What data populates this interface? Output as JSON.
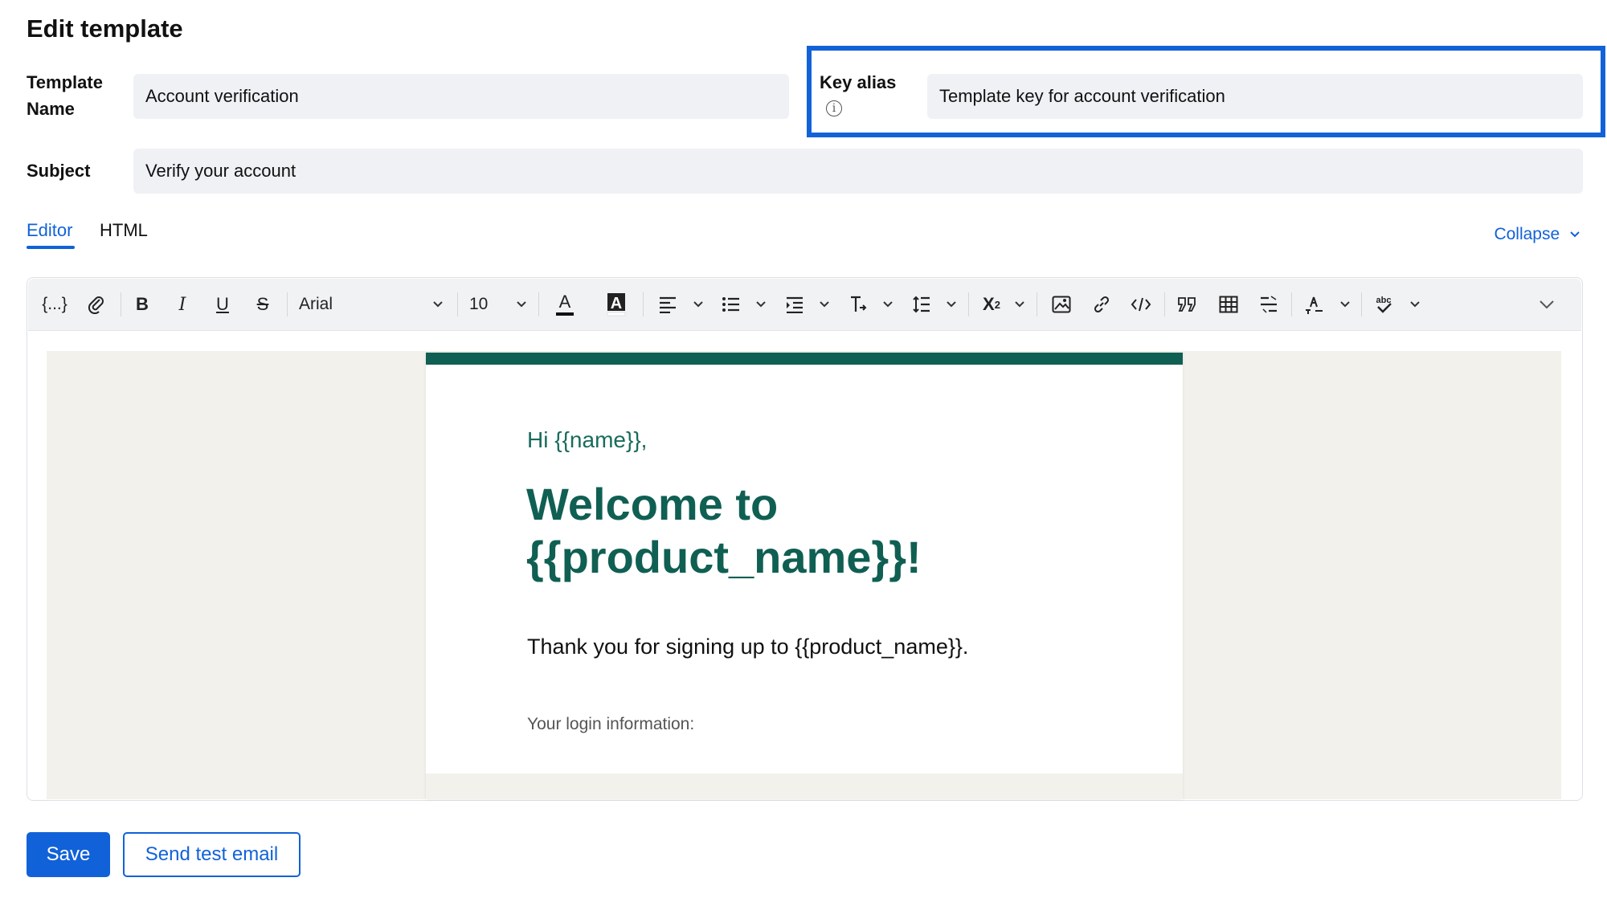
{
  "page": {
    "title": "Edit template"
  },
  "form": {
    "template_name_label_line1": "Template",
    "template_name_label_line2": "Name",
    "template_name_value": "Account verification",
    "key_alias_label": "Key alias",
    "key_alias_value": "Template key for account verification",
    "subject_label": "Subject",
    "subject_value": "Verify your account"
  },
  "tabs": [
    {
      "label": "Editor",
      "active": true
    },
    {
      "label": "HTML",
      "active": false
    }
  ],
  "collapse_label": "Collapse",
  "toolbar": {
    "placeholder_icon": "{...}",
    "font_family": "Arial",
    "font_size": "10",
    "icons": [
      "placeholder-icon",
      "attachment-icon",
      "bold-icon",
      "italic-icon",
      "underline-icon",
      "strikethrough-icon",
      "font-color-icon",
      "highlight-icon",
      "align-icon",
      "bullet-list-icon",
      "indent-icon",
      "clear-format-icon",
      "line-height-icon",
      "superscript-icon",
      "image-icon",
      "link-icon",
      "code-icon",
      "quote-icon",
      "table-icon",
      "horizontal-rule-icon",
      "text-direction-icon",
      "spellcheck-icon",
      "more-chevron-icon"
    ]
  },
  "email": {
    "greeting": "Hi {{name}},",
    "headline_line1": "Welcome to",
    "headline_line2": "{{product_name}}!",
    "body": "Thank you for signing up to {{product_name}}.",
    "login_info": "Your login information:"
  },
  "buttons": {
    "save": "Save",
    "send_test": "Send test email"
  },
  "colors": {
    "accent": "#1162d8",
    "email_brand": "#105f53",
    "input_bg": "#eff1f5"
  }
}
